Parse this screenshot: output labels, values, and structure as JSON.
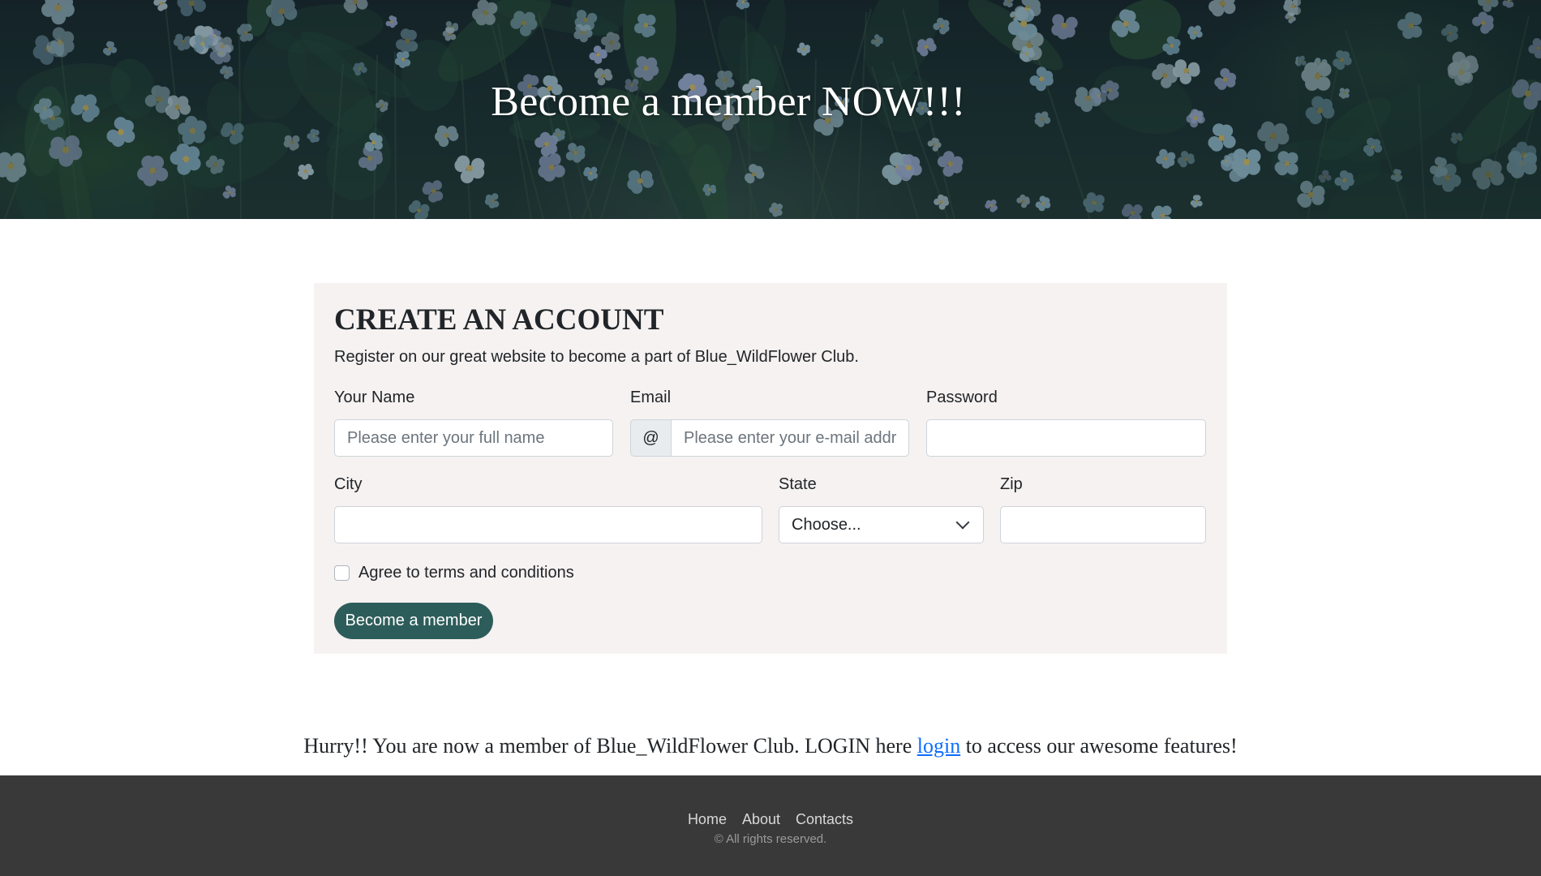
{
  "hero": {
    "title": "Become a member NOW!!!"
  },
  "form": {
    "title": "CREATE AN ACCOUNT",
    "subtitle": "Register on our great website to become a part of Blue_WildFlower Club.",
    "name": {
      "label": "Your Name",
      "placeholder": "Please enter your full name",
      "value": ""
    },
    "email": {
      "label": "Email",
      "addon": "@",
      "placeholder": "Please enter your e-mail address",
      "value": ""
    },
    "password": {
      "label": "Password",
      "value": ""
    },
    "city": {
      "label": "City",
      "value": ""
    },
    "state": {
      "label": "State",
      "selected": "Choose...",
      "icon": "chevron-down-icon"
    },
    "zip": {
      "label": "Zip",
      "value": ""
    },
    "terms": {
      "label": "Agree to terms and conditions",
      "checked": false
    },
    "submit_label": "Become a member",
    "accent_color": "#2d5d5a"
  },
  "notice": {
    "before": "Hurry!! You are now a member of Blue_WildFlower Club. LOGIN here ",
    "link": "login",
    "after": " to access our awesome features!"
  },
  "footer": {
    "links": [
      "Home",
      "About",
      "Contacts"
    ],
    "copyright": "© All rights reserved."
  }
}
